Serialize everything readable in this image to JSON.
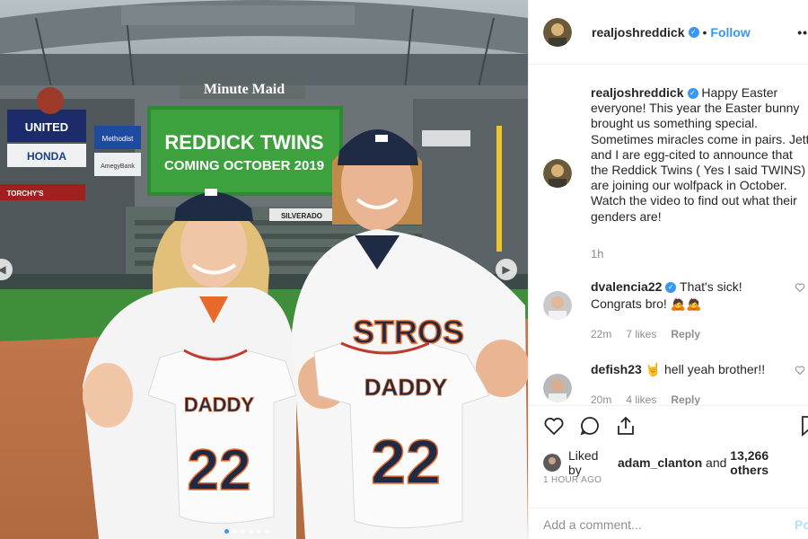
{
  "photo": {
    "stadium_sign": "Minute Maid",
    "board_line1": "REDDICK TWINS",
    "board_line2": "COMING OCTOBER 2019",
    "ad_united": "UNITED",
    "ad_honda": "HONDA",
    "ad_methodist": "Methodist",
    "ad_amegy": "AmegyBank",
    "ad_silverado": "SILVERADO",
    "ad_torchys": "TORCHY'S",
    "jersey_text": "STROS",
    "onesie_left_name": "DADDY",
    "onesie_left_number": "22",
    "onesie_right_name": "DADDY",
    "onesie_right_number": "22",
    "nav_left_icon": "chevron-left-icon",
    "nav_right_icon": "chevron-right-icon"
  },
  "header": {
    "username": "realjoshreddick",
    "separator": "•",
    "follow_label": "Follow",
    "more_label": "•••"
  },
  "caption": {
    "username": "realjoshreddick",
    "text": "Happy Easter everyone! This year the Easter bunny brought us something special. Sometimes miracles come in pairs. Jett and I are egg-cited to announce that the Reddick Twins ( Yes I said TWINS) are joining our wolfpack in October. Watch the video to find out what their genders are!",
    "time": "1h"
  },
  "comments": [
    {
      "username": "dvalencia22",
      "text": "That's sick! Congrats bro! 🙇🙇",
      "time": "22m",
      "likes": "7 likes",
      "reply_label": "Reply"
    },
    {
      "username": "defish23",
      "text": "🤘 hell yeah brother!!",
      "time": "20m",
      "likes": "4 likes",
      "reply_label": "Reply"
    }
  ],
  "actions": {
    "liked_by_prefix": "Liked by",
    "liked_by_user": "adam_clanton",
    "liked_by_and": "and",
    "liked_by_others": "13,266 others",
    "timestamp": "1 HOUR AGO",
    "comment_placeholder": "Add a comment...",
    "post_label": "Post"
  },
  "colors": {
    "accent": "#3897f0",
    "muted": "#8e8e8e",
    "post_disabled": "#b2dffc"
  }
}
